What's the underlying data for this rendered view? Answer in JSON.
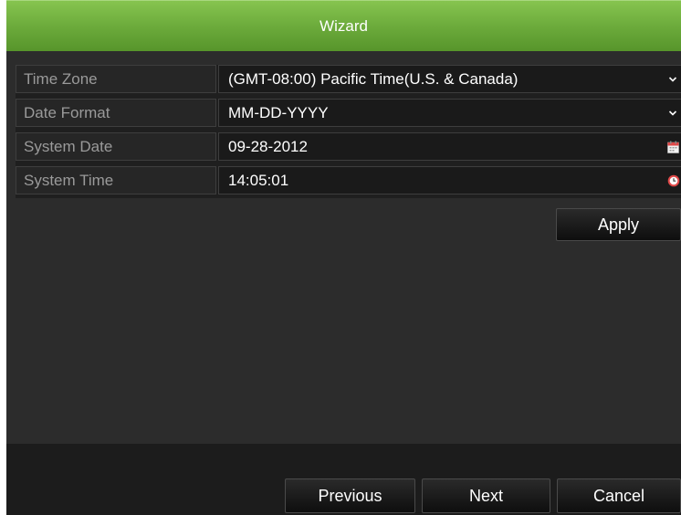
{
  "window": {
    "title": "Wizard"
  },
  "settings": [
    {
      "label": "Time Zone",
      "value": "(GMT-08:00) Pacific Time(U.S. & Canada)",
      "control": "dropdown"
    },
    {
      "label": "Date Format",
      "value": "MM-DD-YYYY",
      "control": "dropdown"
    },
    {
      "label": "System Date",
      "value": "09-28-2012",
      "control": "calendar"
    },
    {
      "label": "System Time",
      "value": "14:05:01",
      "control": "clock"
    }
  ],
  "buttons": {
    "apply": "Apply",
    "previous": "Previous",
    "next": "Next",
    "cancel": "Cancel"
  },
  "icons": {
    "dropdown": "chevron-down-icon",
    "calendar": "calendar-icon",
    "clock": "clock-icon"
  },
  "colors": {
    "title_bar": "#6aa93a",
    "background": "#2c2c2c",
    "calendar_accent": "#e04848",
    "clock_accent": "#e04848"
  }
}
